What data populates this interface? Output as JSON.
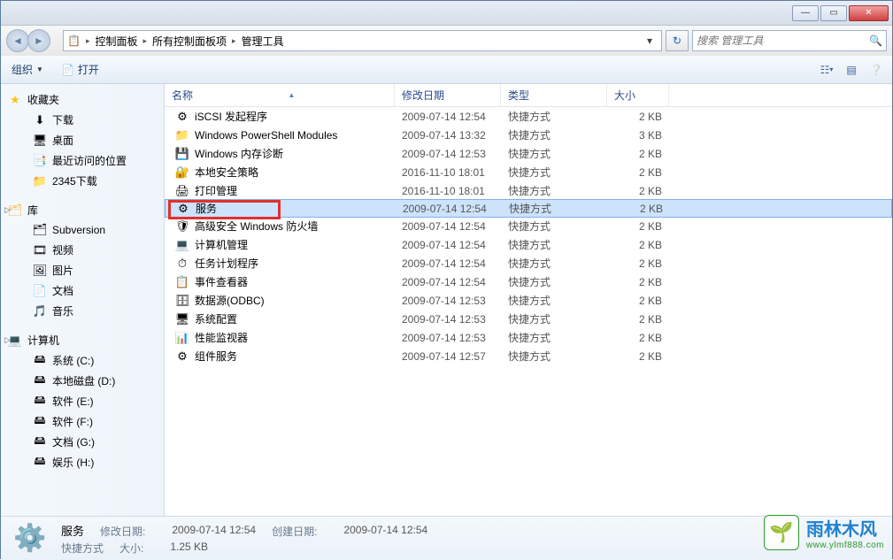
{
  "breadcrumb": {
    "icon": "📋",
    "seg0": "控制面板",
    "seg1": "所有控制面板项",
    "seg2": "管理工具"
  },
  "search": {
    "placeholder": "搜索 管理工具"
  },
  "toolbar": {
    "organize": "组织",
    "open": "打开"
  },
  "columns": {
    "name": "名称",
    "date": "修改日期",
    "type": "类型",
    "size": "大小"
  },
  "sidebar": {
    "fav_header": "收藏夹",
    "favs": [
      {
        "icon": "⬇",
        "label": "下载"
      },
      {
        "icon": "🖥",
        "label": "桌面"
      },
      {
        "icon": "📑",
        "label": "最近访问的位置"
      },
      {
        "icon": "📁",
        "label": "2345下载"
      }
    ],
    "lib_header": "库",
    "libs": [
      {
        "icon": "🗂",
        "label": "Subversion"
      },
      {
        "icon": "🎞",
        "label": "视频"
      },
      {
        "icon": "🖼",
        "label": "图片"
      },
      {
        "icon": "📄",
        "label": "文档"
      },
      {
        "icon": "🎵",
        "label": "音乐"
      }
    ],
    "computer_header": "计算机",
    "drives": [
      {
        "icon": "🖴",
        "label": "系统 (C:)"
      },
      {
        "icon": "🖴",
        "label": "本地磁盘 (D:)"
      },
      {
        "icon": "🖴",
        "label": "软件 (E:)"
      },
      {
        "icon": "🖴",
        "label": "软件 (F:)"
      },
      {
        "icon": "🖴",
        "label": "文档 (G:)"
      },
      {
        "icon": "🖴",
        "label": "娱乐 (H:)"
      }
    ]
  },
  "files": [
    {
      "icon": "⚙",
      "name": "iSCSI 发起程序",
      "date": "2009-07-14 12:54",
      "type": "快捷方式",
      "size": "2 KB"
    },
    {
      "icon": "📁",
      "name": "Windows PowerShell Modules",
      "date": "2009-07-14 13:32",
      "type": "快捷方式",
      "size": "3 KB"
    },
    {
      "icon": "💾",
      "name": "Windows 内存诊断",
      "date": "2009-07-14 12:53",
      "type": "快捷方式",
      "size": "2 KB"
    },
    {
      "icon": "🔐",
      "name": "本地安全策略",
      "date": "2016-11-10 18:01",
      "type": "快捷方式",
      "size": "2 KB"
    },
    {
      "icon": "🖨",
      "name": "打印管理",
      "date": "2016-11-10 18:01",
      "type": "快捷方式",
      "size": "2 KB"
    },
    {
      "icon": "⚙",
      "name": "服务",
      "date": "2009-07-14 12:54",
      "type": "快捷方式",
      "size": "2 KB",
      "selected": true
    },
    {
      "icon": "🛡",
      "name": "高级安全 Windows 防火墙",
      "date": "2009-07-14 12:54",
      "type": "快捷方式",
      "size": "2 KB"
    },
    {
      "icon": "💻",
      "name": "计算机管理",
      "date": "2009-07-14 12:54",
      "type": "快捷方式",
      "size": "2 KB"
    },
    {
      "icon": "⏱",
      "name": "任务计划程序",
      "date": "2009-07-14 12:54",
      "type": "快捷方式",
      "size": "2 KB"
    },
    {
      "icon": "📋",
      "name": "事件查看器",
      "date": "2009-07-14 12:54",
      "type": "快捷方式",
      "size": "2 KB"
    },
    {
      "icon": "🗄",
      "name": "数据源(ODBC)",
      "date": "2009-07-14 12:53",
      "type": "快捷方式",
      "size": "2 KB"
    },
    {
      "icon": "🖥",
      "name": "系统配置",
      "date": "2009-07-14 12:53",
      "type": "快捷方式",
      "size": "2 KB"
    },
    {
      "icon": "📊",
      "name": "性能监视器",
      "date": "2009-07-14 12:53",
      "type": "快捷方式",
      "size": "2 KB"
    },
    {
      "icon": "⚙",
      "name": "组件服务",
      "date": "2009-07-14 12:57",
      "type": "快捷方式",
      "size": "2 KB"
    }
  ],
  "details": {
    "title": "服务",
    "subtitle": "快捷方式",
    "mod_lbl": "修改日期:",
    "mod_val": "2009-07-14 12:54",
    "create_lbl": "创建日期:",
    "create_val": "2009-07-14 12:54",
    "size_lbl": "大小:",
    "size_val": "1.25 KB"
  },
  "watermark": {
    "cn": "雨林木风",
    "en": "www.ylmf888.com"
  }
}
